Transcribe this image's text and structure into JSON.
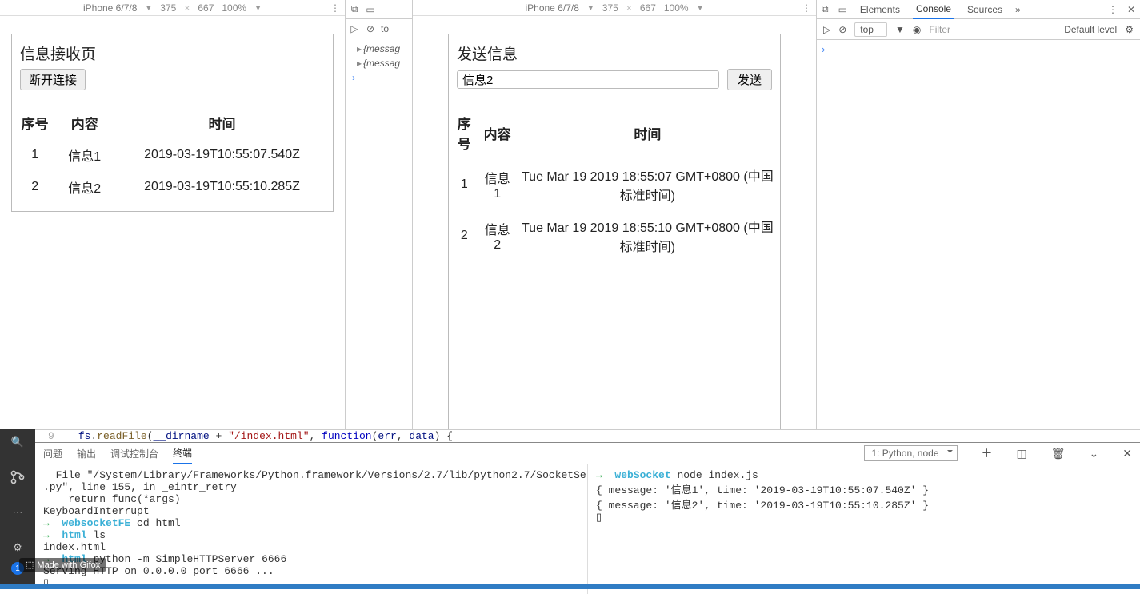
{
  "deviceBar": {
    "name": "iPhone 6/7/8",
    "width": "375",
    "height": "667",
    "zoom": "100%"
  },
  "receive": {
    "title": "信息接收页",
    "disconnect": "断开连接",
    "headers": {
      "seq": "序号",
      "content": "内容",
      "time": "时间"
    },
    "rows": [
      {
        "seq": "1",
        "content": "信息1",
        "time": "2019-03-19T10:55:07.540Z"
      },
      {
        "seq": "2",
        "content": "信息2",
        "time": "2019-03-19T10:55:10.285Z"
      }
    ]
  },
  "miniConsole": {
    "topLabel": "to",
    "lines": [
      "{messag",
      "{messag"
    ]
  },
  "send": {
    "title": "发送信息",
    "inputValue": "信息2",
    "sendBtn": "发送",
    "headers": {
      "seq": "序号",
      "content": "内容",
      "time": "时间"
    },
    "rows": [
      {
        "seq": "1",
        "content": "信息1",
        "time": "Tue Mar 19 2019 18:55:07 GMT+0800 (中国标准时间)"
      },
      {
        "seq": "2",
        "content": "信息2",
        "time": "Tue Mar 19 2019 18:55:10 GMT+0800 (中国标准时间)"
      }
    ]
  },
  "devtools": {
    "tabs": {
      "elements": "Elements",
      "console": "Console",
      "sources": "Sources"
    },
    "contextSel": "top",
    "filter": "Filter",
    "level": "Default level"
  },
  "codePeek": {
    "line": "9",
    "text_plain": "fs.readFile(__dirname + \"/index.html\", function(err, data) {"
  },
  "termTabs": {
    "problems": "问题",
    "output": "输出",
    "debug": "调试控制台",
    "terminal": "终端",
    "selector": "1: Python, node"
  },
  "termLeft": "  File \"/System/Library/Frameworks/Python.framework/Versions/2.7/lib/python2.7/SocketServer\n.py\", line 155, in _eintr_retry\n    return func(*args)\nKeyboardInterrupt\n→  websocketFE cd html\n→  html ls\nindex.html\n→  html python -m SimpleHTTPServer 6666\nServing HTTP on 0.0.0.0 port 6666 ...\n▯",
  "termRight": "→  webSocket node index.js\n{ message: '信息1', time: '2019-03-19T10:55:07.540Z' }\n{ message: '信息2', time: '2019-03-19T10:55:10.285Z' }\n▯",
  "watermark": "Made with Gifox",
  "sidebarBadge": "1"
}
